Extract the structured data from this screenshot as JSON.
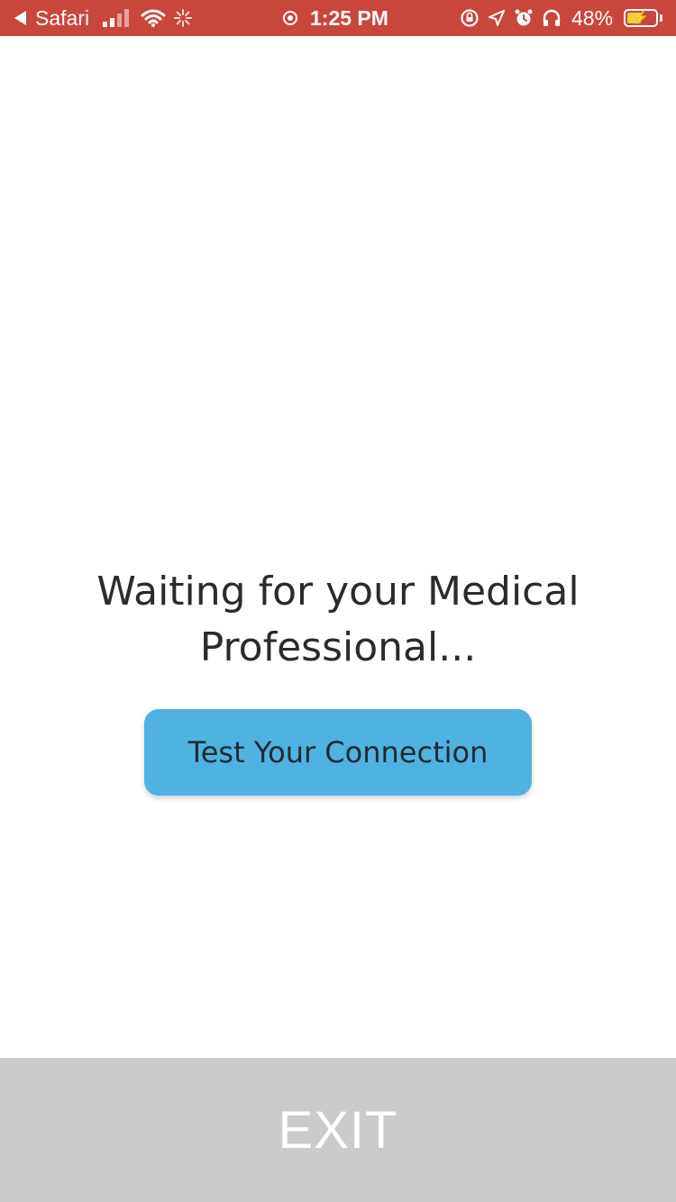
{
  "status_bar": {
    "back_app": "Safari",
    "time": "1:25 PM",
    "battery_percent": "48%",
    "battery_level": 0.48,
    "signal_bars": 2,
    "colors": {
      "background": "#c9463d",
      "battery_fill": "#f3cc3b"
    },
    "icons": [
      "back-arrow-icon",
      "signal-icon",
      "wifi-icon",
      "loading-spinner-icon",
      "screen-record-icon",
      "rotation-lock-icon",
      "location-icon",
      "alarm-icon",
      "headphones-icon",
      "battery-icon"
    ]
  },
  "main": {
    "message_line1": "Waiting for your Medical",
    "message_line2": "Professional...",
    "test_button_label": "Test Your Connection",
    "colors": {
      "button": "#4fb2e0",
      "text": "#2b2b2b"
    }
  },
  "footer": {
    "exit_label": "EXIT",
    "color": "#cdcbca"
  }
}
